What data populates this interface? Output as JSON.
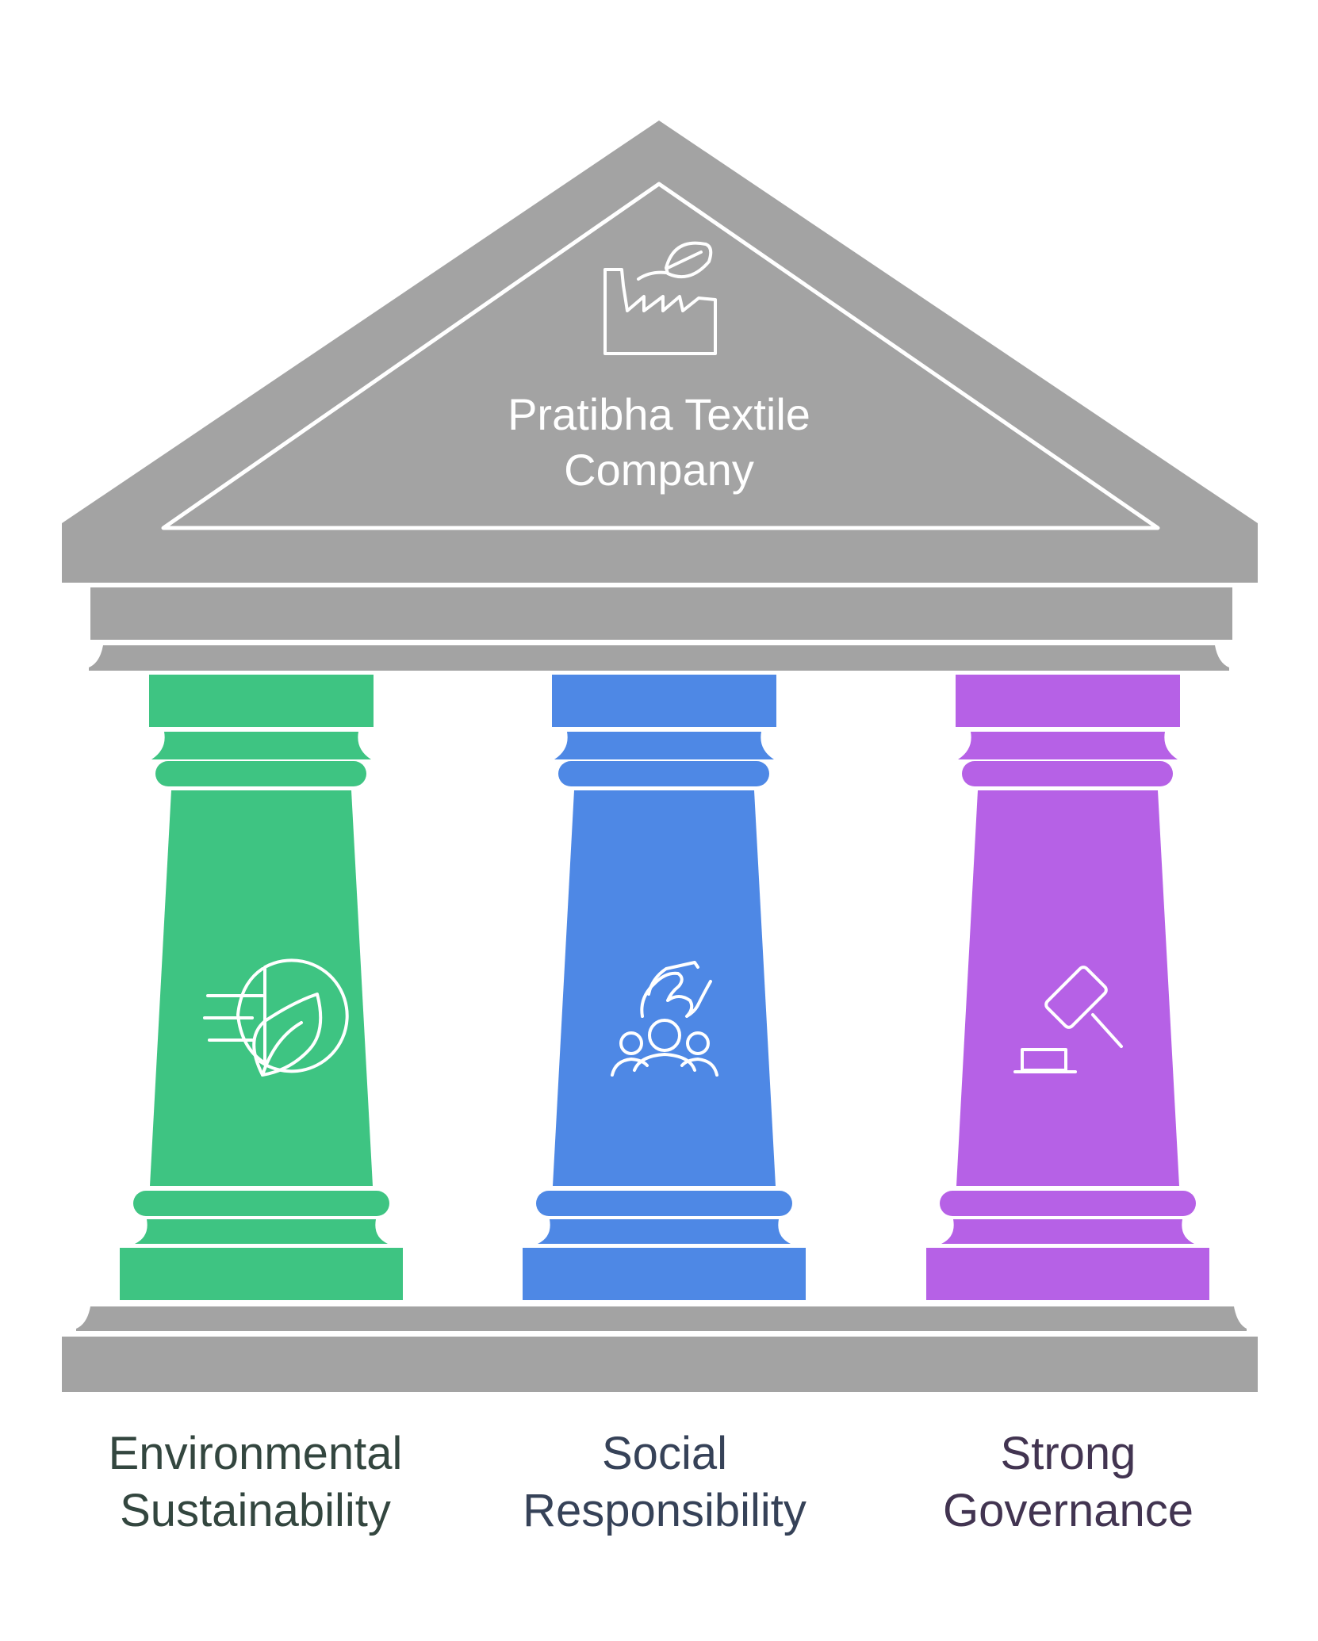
{
  "roof": {
    "title_line1": "Pratibha Textile",
    "title_line2": "Company",
    "icon": "factory-leaf-icon"
  },
  "colors": {
    "stone": "#a3a3a3",
    "environmental": "#3ec482",
    "social": "#4e88e5",
    "governance": "#b661e6",
    "label_text": "#3d4a4a"
  },
  "pillars": [
    {
      "line1": "Environmental",
      "line2": "Sustainability",
      "icon": "globe-leaf-icon",
      "color": "#3ec482",
      "text_color": "#33463f"
    },
    {
      "line1": "Social",
      "line2": "Responsibility",
      "icon": "hand-community-icon",
      "color": "#4e88e5",
      "text_color": "#364258"
    },
    {
      "line1": "Strong",
      "line2": "Governance",
      "icon": "gavel-icon",
      "color": "#b661e6",
      "text_color": "#423451"
    }
  ]
}
